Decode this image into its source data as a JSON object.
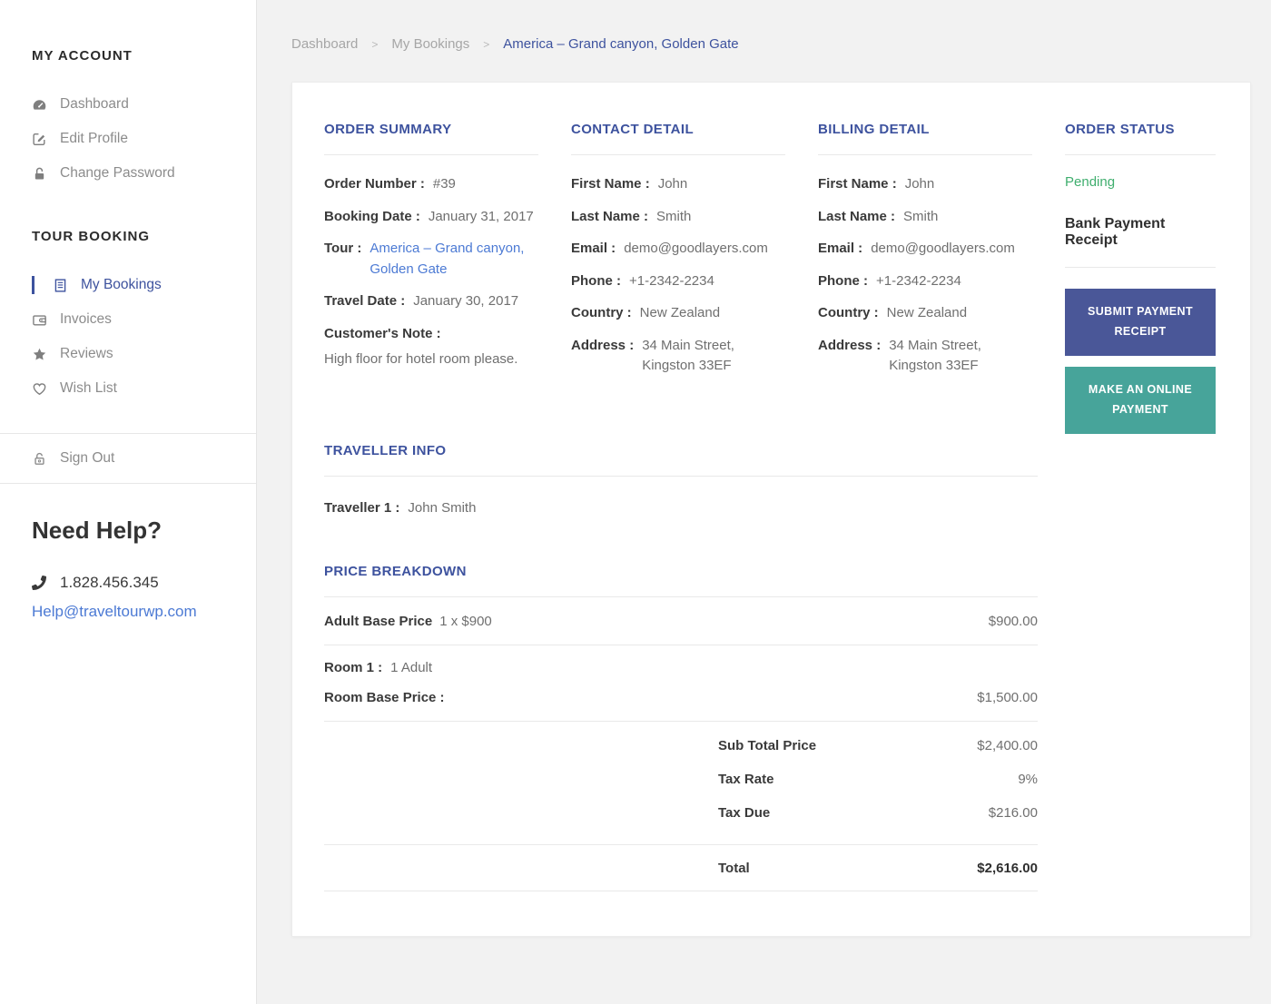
{
  "colors": {
    "accent_blue": "#3d529e",
    "link_blue": "#4c7ad4",
    "status_green": "#3fae6e",
    "button_blue": "#4a5798",
    "button_teal": "#47a49a"
  },
  "sidebar": {
    "sections": [
      {
        "title": "MY ACCOUNT",
        "items": [
          {
            "label": "Dashboard",
            "icon": "dashboard-icon"
          },
          {
            "label": "Edit Profile",
            "icon": "edit-icon"
          },
          {
            "label": "Change Password",
            "icon": "lock-icon"
          }
        ]
      },
      {
        "title": "TOUR BOOKING",
        "items": [
          {
            "label": "My Bookings",
            "icon": "bookings-icon",
            "active": true
          },
          {
            "label": "Invoices",
            "icon": "wallet-icon"
          },
          {
            "label": "Reviews",
            "icon": "star-icon"
          },
          {
            "label": "Wish List",
            "icon": "heart-icon"
          }
        ]
      }
    ],
    "sign_out_label": "Sign Out",
    "help": {
      "title": "Need Help?",
      "phone": "1.828.456.345",
      "email": "Help@traveltourwp.com"
    }
  },
  "breadcrumb": {
    "separator": ">",
    "items": [
      {
        "label": "Dashboard"
      },
      {
        "label": "My Bookings"
      },
      {
        "label": "America – Grand canyon, Golden Gate"
      }
    ]
  },
  "order_summary": {
    "title": "ORDER SUMMARY",
    "order_number_label": "Order Number :",
    "order_number": "#39",
    "booking_date_label": "Booking Date :",
    "booking_date": "January 31, 2017",
    "tour_label": "Tour :",
    "tour": "America – Grand canyon, Golden Gate",
    "travel_date_label": "Travel Date :",
    "travel_date": "January 30, 2017",
    "customer_note_label": "Customer's Note :",
    "customer_note": "High floor for hotel room please."
  },
  "contact_detail": {
    "title": "CONTACT DETAIL",
    "first_name_label": "First Name :",
    "first_name": "John",
    "last_name_label": "Last Name :",
    "last_name": "Smith",
    "email_label": "Email :",
    "email": "demo@goodlayers.com",
    "phone_label": "Phone :",
    "phone": "+1-2342-2234",
    "country_label": "Country :",
    "country": "New Zealand",
    "address_label": "Address :",
    "address": "34 Main Street, Kingston 33EF"
  },
  "billing_detail": {
    "title": "BILLING DETAIL",
    "first_name_label": "First Name :",
    "first_name": "John",
    "last_name_label": "Last Name :",
    "last_name": "Smith",
    "email_label": "Email :",
    "email": "demo@goodlayers.com",
    "phone_label": "Phone :",
    "phone": "+1-2342-2234",
    "country_label": "Country :",
    "country": "New Zealand",
    "address_label": "Address :",
    "address": "34 Main Street, Kingston 33EF"
  },
  "order_status": {
    "title": "ORDER STATUS",
    "status": "Pending",
    "receipt_title": "Bank Payment Receipt",
    "submit_button": "SUBMIT PAYMENT RECEIPT",
    "online_button": "MAKE AN ONLINE PAYMENT"
  },
  "traveller_info": {
    "title": "TRAVELLER INFO",
    "traveller_label": "Traveller 1 :",
    "traveller_name": "John Smith"
  },
  "price_breakdown": {
    "title": "PRICE BREAKDOWN",
    "adult_label": "Adult Base Price",
    "adult_qty": "1 x $900",
    "adult_total": "$900.00",
    "room_label": "Room 1 :",
    "room_occupancy": "1 Adult",
    "room_price_label": "Room Base Price :",
    "room_price": "$1,500.00",
    "subtotal_label": "Sub Total Price",
    "subtotal": "$2,400.00",
    "tax_rate_label": "Tax Rate",
    "tax_rate": "9%",
    "tax_due_label": "Tax Due",
    "tax_due": "$216.00",
    "total_label": "Total",
    "total": "$2,616.00"
  }
}
